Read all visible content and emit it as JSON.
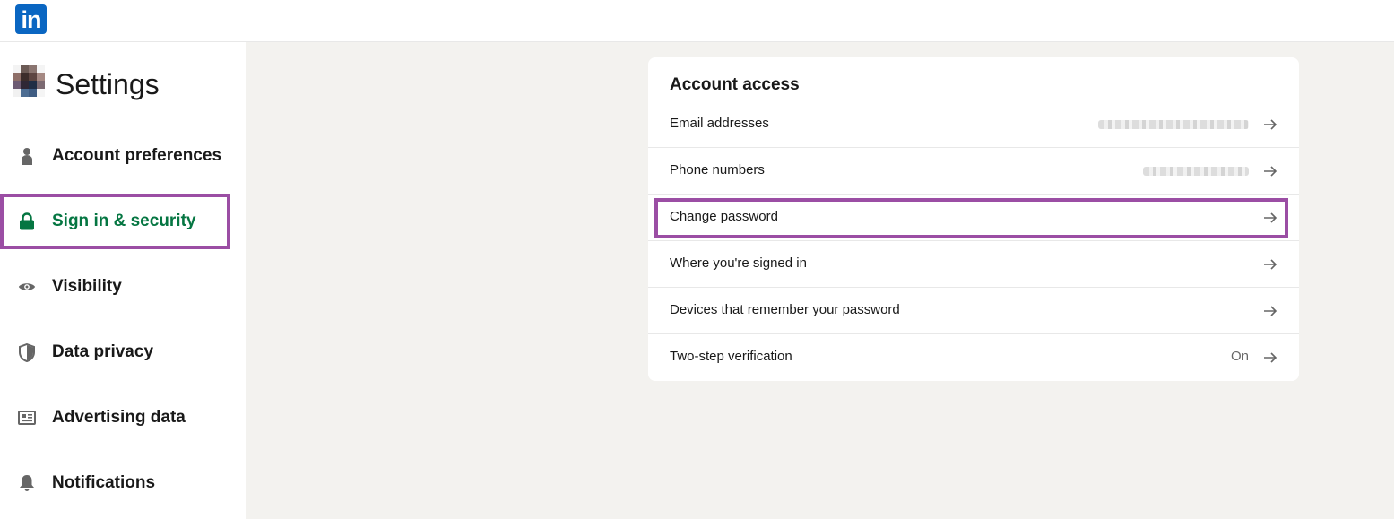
{
  "header": {
    "logo_text": "in",
    "logo_color": "#0a66c2"
  },
  "sidebar": {
    "title": "Settings",
    "items": [
      {
        "label": "Account preferences",
        "icon": "person-icon",
        "active": false
      },
      {
        "label": "Sign in & security",
        "icon": "lock-icon",
        "active": true
      },
      {
        "label": "Visibility",
        "icon": "eye-icon",
        "active": false
      },
      {
        "label": "Data privacy",
        "icon": "shield-icon",
        "active": false
      },
      {
        "label": "Advertising data",
        "icon": "newspaper-icon",
        "active": false
      },
      {
        "label": "Notifications",
        "icon": "bell-icon",
        "active": false
      }
    ]
  },
  "account_access": {
    "title": "Account access",
    "rows": [
      {
        "label": "Email addresses",
        "value": "",
        "value_redacted": true
      },
      {
        "label": "Phone numbers",
        "value": "",
        "value_redacted": true
      },
      {
        "label": "Change password",
        "value": "",
        "highlighted": true
      },
      {
        "label": "Where you're signed in",
        "value": ""
      },
      {
        "label": "Devices that remember your password",
        "value": ""
      },
      {
        "label": "Two-step verification",
        "value": "On"
      }
    ]
  },
  "colors": {
    "active_green": "#057642",
    "highlight_purple": "#9b4ea4",
    "page_background": "#f3f2ef"
  }
}
